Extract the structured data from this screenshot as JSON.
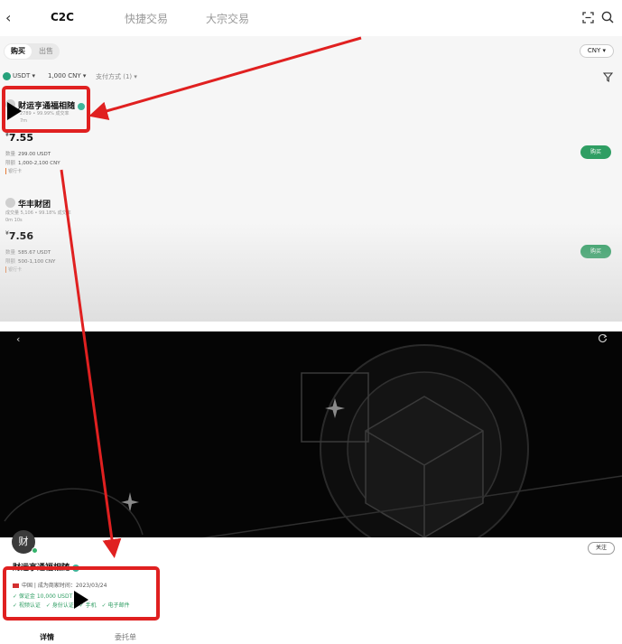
{
  "top": {
    "header": {
      "tabs": [
        {
          "label": "C2C",
          "active": true
        },
        {
          "label": "快捷交易",
          "active": false
        },
        {
          "label": "大宗交易",
          "active": false
        }
      ]
    },
    "segment": {
      "buy": "购买",
      "sell": "出售"
    },
    "currency": "CNY ▾",
    "filters": {
      "asset": "USDT ▾",
      "amount": "1,000 CNY ▾",
      "payment": "支付方式 (1) ▾"
    },
    "ads": [
      {
        "merchant": "财运亨通福相随",
        "stats": "2789 • 99.99% 成交率",
        "time": "7m",
        "currency_symbol": "¥",
        "price": "7.55",
        "qty_label": "数量",
        "qty": "299.00 USDT",
        "limit_label": "限额",
        "limit": "1,000-2,100 CNY",
        "payment": "银行卡",
        "button": "购买"
      },
      {
        "merchant": "华丰财团",
        "stats": "成交量 5,106 • 99.18% 成交率",
        "time": "0m 10s",
        "currency_symbol": "¥",
        "price": "7.56",
        "qty_label": "数量",
        "qty": "585.67 USDT",
        "limit_label": "限额",
        "limit": "500-1,100 CNY",
        "payment": "银行卡",
        "button": "购买"
      }
    ]
  },
  "bottom": {
    "avatar_text": "财",
    "follow": "关注",
    "name": "财运亨通福相随",
    "info": "中国 | 成为商家时间：2023/03/24",
    "deposit": "✓ 保证金 10,000 USDT",
    "certifications": [
      "✓ 视频认证",
      "✓ 身份认证",
      "✓ 手机",
      "✓ 电子邮件"
    ],
    "tabs": {
      "details": "详情",
      "orders": "委托单"
    }
  },
  "colors": {
    "highlight": "#e02020",
    "buy_button": "#2f9e63",
    "verified": "#3fb59a",
    "banner": "#050505"
  }
}
